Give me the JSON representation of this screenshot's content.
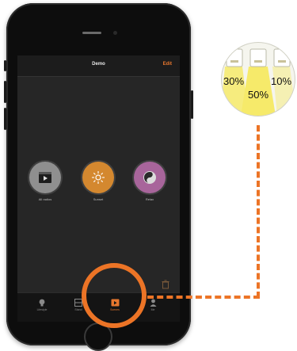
{
  "app": {
    "title": "Demo",
    "edit_label": "Edit"
  },
  "categories": [
    {
      "label": "All radios",
      "icon": "radio-player-icon",
      "color": "#8f8f8f"
    },
    {
      "label": "Sunset",
      "icon": "sunset-icon",
      "color": "#d4882f"
    },
    {
      "label": "Relax",
      "icon": "yin-yang-icon",
      "color": "#a8659b"
    }
  ],
  "tabs": [
    {
      "label": "Lifestyle",
      "icon": "bulb-icon",
      "active": false
    },
    {
      "label": "Stand",
      "icon": "grid-icon",
      "active": false
    },
    {
      "label": "Scenes",
      "icon": "scenes-icon",
      "active": true
    },
    {
      "label": "Me",
      "icon": "person-icon",
      "active": false
    }
  ],
  "light_distribution": {
    "left": "30%",
    "center": "50%",
    "right": "10%"
  },
  "colors": {
    "accent": "#ec7426",
    "screen_bg": "#262626",
    "light_yellow": "#f6ea6a"
  }
}
